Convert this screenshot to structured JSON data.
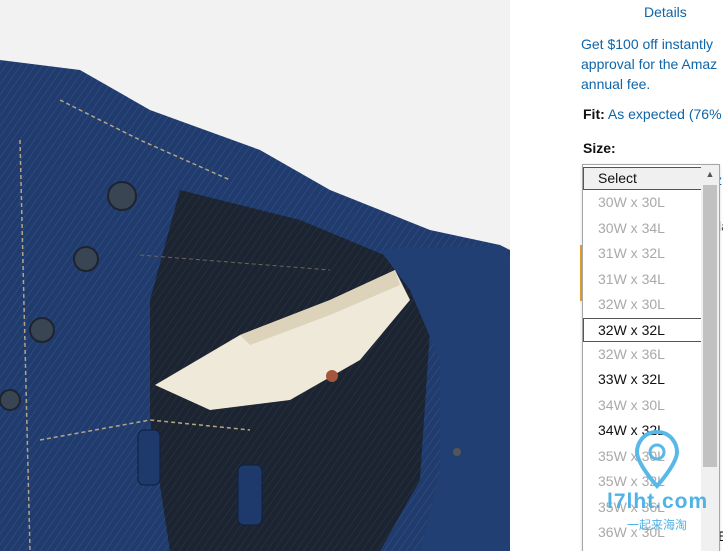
{
  "header": {
    "details_link": "Details"
  },
  "promo": {
    "line1": "Get $100 off instantly",
    "line2": "approval for the Amaz",
    "line3": "annual fee."
  },
  "fit": {
    "label": "Fit:",
    "value": "As expected (76%"
  },
  "size": {
    "label": "Size:",
    "options": [
      {
        "label": "Select",
        "state": "selected"
      },
      {
        "label": "30W x 30L",
        "state": "unavailable"
      },
      {
        "label": "30W x 34L",
        "state": "unavailable"
      },
      {
        "label": "31W x 32L",
        "state": "unavailable"
      },
      {
        "label": "31W x 34L",
        "state": "unavailable"
      },
      {
        "label": "32W x 30L",
        "state": "unavailable"
      },
      {
        "label": "32W x 32L",
        "state": "hovered"
      },
      {
        "label": "32W x 36L",
        "state": "unavailable"
      },
      {
        "label": "33W x 32L",
        "state": "available"
      },
      {
        "label": "34W x 30L",
        "state": "unavailable"
      },
      {
        "label": "34W x 32L",
        "state": "available"
      },
      {
        "label": "35W x 30L",
        "state": "unavailable"
      },
      {
        "label": "35W x 32L",
        "state": "unavailable"
      },
      {
        "label": "35W x 36L",
        "state": "unavailable"
      },
      {
        "label": "36W x 30L",
        "state": "unavailable"
      }
    ]
  },
  "peek": {
    "a": "z",
    "b": "la",
    "c": "E"
  },
  "watermark": {
    "text": "l7lht.com",
    "subtext": "一起来海淘"
  },
  "colors": {
    "link": "#0f65a8",
    "accent": "#e7a12b",
    "denim": "#1f3a6a"
  },
  "icons": {
    "scroll_up": "triangle-up-icon"
  }
}
